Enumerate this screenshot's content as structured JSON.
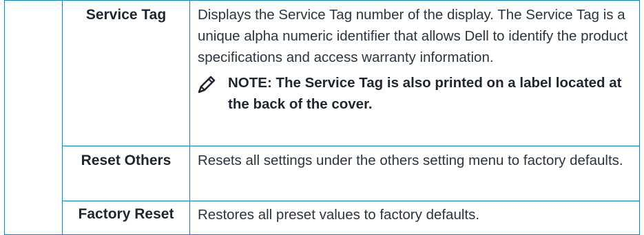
{
  "rows": [
    {
      "name": "Service Tag",
      "description": "Displays the Service Tag number of the display. The Service Tag is a unique alpha numeric identifier that allows Dell to identify the product specifications and access warranty information.",
      "note": "NOTE: The Service Tag is also printed on a label located at the back of the cover."
    },
    {
      "name": "Reset Others",
      "description": "Resets all settings under the others setting menu to factory defaults."
    },
    {
      "name": "Factory Reset",
      "description": "Restores all preset values to factory defaults."
    }
  ],
  "colors": {
    "border": "#0a84c8",
    "text": "#2b3540"
  },
  "icons": {
    "note": "pencil-note-icon"
  }
}
